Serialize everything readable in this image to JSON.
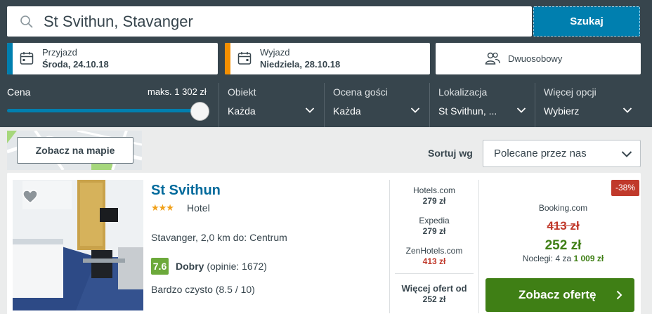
{
  "search": {
    "query": "St Svithun, Stavanger",
    "button_label": "Szukaj"
  },
  "dates": {
    "checkin_label": "Przyjazd",
    "checkin_value": "Środa, 24.10.18",
    "checkin_color": "#007faf",
    "checkout_label": "Wyjazd",
    "checkout_value": "Niedziela, 28.10.18",
    "checkout_color": "#f48f00"
  },
  "room": {
    "label": "Dwuosobowy",
    "icon": "people-icon"
  },
  "filters": {
    "price_label": "Cena",
    "price_max": "maks. 1 302 zł",
    "price_slider_fraction": 1.0,
    "columns": [
      {
        "label": "Obiekt",
        "value": "Każda"
      },
      {
        "label": "Ocena gości",
        "value": "Każda"
      },
      {
        "label": "Lokalizacja",
        "value": "St Svithun, ..."
      },
      {
        "label": "Więcej opcji",
        "value": "Wybierz"
      }
    ]
  },
  "map": {
    "button_label": "Zobacz na mapie"
  },
  "sort": {
    "label": "Sortuj wg",
    "selected": "Polecane przez nas"
  },
  "hotel": {
    "name": "St Svithun",
    "stars": "★★★",
    "star_count": 3,
    "type": "Hotel",
    "location": "Stavanger, 2,0 km do: Centrum",
    "score": "7.6",
    "rating_word": "Dobry",
    "reviews": "(opinie: 1672)",
    "cleanliness": "Bardzo czysto (8.5 / 10)"
  },
  "partners": [
    {
      "name": "Hotels.com",
      "price": "279 zł",
      "highlight": false
    },
    {
      "name": "Expedia",
      "price": "279 zł",
      "highlight": false
    },
    {
      "name": "ZenHotels.com",
      "price": "413 zł",
      "highlight": true
    }
  ],
  "more_offers": {
    "label": "Więcej ofert od",
    "price": "252 zł"
  },
  "deal": {
    "discount": "-38%",
    "site": "Booking.com",
    "old_price": "413 zł",
    "new_price": "252 zł",
    "nights_text": "Noclegi: 4 za",
    "total": "1 009 zł",
    "button_label": "Zobacz ofertę"
  },
  "colors": {
    "header_bg": "#37454d",
    "accent_blue": "#007faf",
    "deal_green": "#3f7f15",
    "discount_red": "#c0392b",
    "score_green": "#6ca93b"
  }
}
